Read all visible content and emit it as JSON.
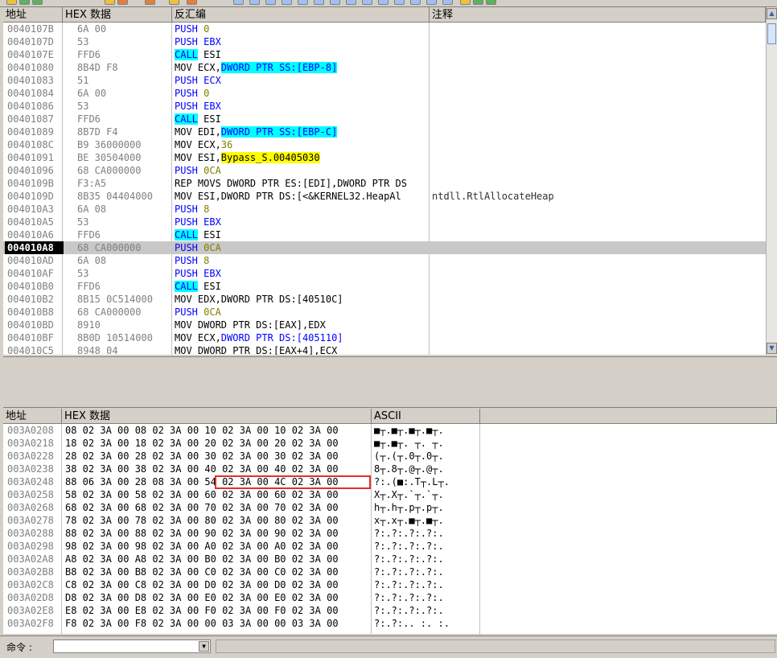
{
  "cpu": {
    "headers": {
      "address": "地址",
      "hex": "HEX 数据",
      "disasm": "反汇编",
      "comment": "注释"
    },
    "rows": [
      {
        "addr": "0040107B",
        "hex": "6A 00",
        "parts": [
          [
            "PUSH ",
            "blue"
          ],
          [
            "0",
            "olive"
          ]
        ]
      },
      {
        "addr": "0040107D",
        "hex": "53",
        "parts": [
          [
            "PUSH EBX",
            "blue"
          ]
        ]
      },
      {
        "addr": "0040107E",
        "hex": "FFD6",
        "parts": [
          [
            "CALL",
            "blue cyan"
          ],
          [
            " ESI",
            "mn"
          ]
        ]
      },
      {
        "addr": "00401080",
        "hex": "8B4D F8",
        "parts": [
          [
            "MOV ECX,",
            "mn"
          ],
          [
            "DWORD PTR SS:[EBP-8]",
            "blue cyan"
          ]
        ]
      },
      {
        "addr": "00401083",
        "hex": "51",
        "parts": [
          [
            "PUSH ECX",
            "blue"
          ]
        ]
      },
      {
        "addr": "00401084",
        "hex": "6A 00",
        "parts": [
          [
            "PUSH ",
            "blue"
          ],
          [
            "0",
            "olive"
          ]
        ]
      },
      {
        "addr": "00401086",
        "hex": "53",
        "parts": [
          [
            "PUSH EBX",
            "blue"
          ]
        ]
      },
      {
        "addr": "00401087",
        "hex": "FFD6",
        "parts": [
          [
            "CALL",
            "blue cyan"
          ],
          [
            " ESI",
            "mn"
          ]
        ]
      },
      {
        "addr": "00401089",
        "hex": "8B7D F4",
        "parts": [
          [
            "MOV EDI,",
            "mn"
          ],
          [
            "DWORD PTR SS:[EBP-C]",
            "blue cyan"
          ]
        ]
      },
      {
        "addr": "0040108C",
        "hex": "B9 36000000",
        "parts": [
          [
            "MOV ECX,",
            "mn"
          ],
          [
            "36",
            "olive"
          ]
        ]
      },
      {
        "addr": "00401091",
        "hex": "BE 30504000",
        "parts": [
          [
            "MOV ESI,",
            "mn"
          ],
          [
            "Bypass_S.00405030",
            "yel"
          ]
        ]
      },
      {
        "addr": "00401096",
        "hex": "68 CA000000",
        "parts": [
          [
            "PUSH ",
            "blue"
          ],
          [
            "0CA",
            "olive"
          ]
        ]
      },
      {
        "addr": "0040109B",
        "hex": "F3:A5",
        "parts": [
          [
            "REP MOVS DWORD PTR ES:[EDI],DWORD PTR DS",
            "mn"
          ]
        ]
      },
      {
        "addr": "0040109D",
        "hex": "8B35 04404000",
        "parts": [
          [
            "MOV ESI,DWORD PTR DS:[<&KERNEL32.HeapAl",
            "mn"
          ]
        ],
        "comment": "ntdll.RtlAllocateHeap"
      },
      {
        "addr": "004010A3",
        "hex": "6A 08",
        "parts": [
          [
            "PUSH ",
            "blue"
          ],
          [
            "8",
            "olive"
          ]
        ]
      },
      {
        "addr": "004010A5",
        "hex": "53",
        "parts": [
          [
            "PUSH EBX",
            "blue"
          ]
        ]
      },
      {
        "addr": "004010A6",
        "hex": "FFD6",
        "parts": [
          [
            "CALL",
            "blue cyan"
          ],
          [
            " ESI",
            "mn"
          ]
        ]
      },
      {
        "addr": "004010A8",
        "hex": "68 CA000000",
        "parts": [
          [
            "PUSH ",
            "blue"
          ],
          [
            "0CA",
            "olive"
          ]
        ],
        "current": true
      },
      {
        "addr": "004010AD",
        "hex": "6A 08",
        "parts": [
          [
            "PUSH ",
            "blue"
          ],
          [
            "8",
            "olive"
          ]
        ]
      },
      {
        "addr": "004010AF",
        "hex": "53",
        "parts": [
          [
            "PUSH EBX",
            "blue"
          ]
        ]
      },
      {
        "addr": "004010B0",
        "hex": "FFD6",
        "parts": [
          [
            "CALL",
            "blue cyan"
          ],
          [
            " ESI",
            "mn"
          ]
        ]
      },
      {
        "addr": "004010B2",
        "hex": "8B15 0C514000",
        "parts": [
          [
            "MOV EDX,DWORD PTR DS:[40510C]",
            "mn"
          ]
        ]
      },
      {
        "addr": "004010B8",
        "hex": "68 CA000000",
        "parts": [
          [
            "PUSH ",
            "blue"
          ],
          [
            "0CA",
            "olive"
          ]
        ]
      },
      {
        "addr": "004010BD",
        "hex": "8910",
        "parts": [
          [
            "MOV DWORD PTR DS:[EAX],EDX",
            "mn"
          ]
        ]
      },
      {
        "addr": "004010BF",
        "hex": "8B0D 10514000",
        "parts": [
          [
            "MOV ECX,",
            "mn"
          ],
          [
            "DWORD PTR DS:[405110]",
            "blue"
          ]
        ]
      },
      {
        "addr": "004010C5",
        "hex": "8948 04",
        "parts": [
          [
            "MOV DWORD PTR DS:[EAX+4],ECX",
            "mn"
          ]
        ]
      }
    ]
  },
  "dump": {
    "headers": {
      "address": "地址",
      "hex": "HEX 数据",
      "ascii": "ASCII"
    },
    "rows": [
      {
        "addr": "003A0208",
        "hex": "08 02 3A 00 08 02 3A 00 10 02 3A 00 10 02 3A 00",
        "ascii": "■┬.■┬.■┬.■┬."
      },
      {
        "addr": "003A0218",
        "hex": "18 02 3A 00 18 02 3A 00 20 02 3A 00 20 02 3A 00",
        "ascii": "■┬.■┬. ┬. ┬."
      },
      {
        "addr": "003A0228",
        "hex": "28 02 3A 00 28 02 3A 00 30 02 3A 00 30 02 3A 00",
        "ascii": "(┬.(┬.0┬.0┬."
      },
      {
        "addr": "003A0238",
        "hex": "38 02 3A 00 38 02 3A 00 40 02 3A 00 40 02 3A 00",
        "ascii": "8┬.8┬.@┬.@┬."
      },
      {
        "addr": "003A0248",
        "hex": "88 06 3A 00 28 08 3A 00 54 02 3A 00 4C 02 3A 00",
        "ascii": "?:.(■:.T┬.L┬."
      },
      {
        "addr": "003A0258",
        "hex": "58 02 3A 00 58 02 3A 00 60 02 3A 00 60 02 3A 00",
        "ascii": "X┬.X┬.`┬.`┬."
      },
      {
        "addr": "003A0268",
        "hex": "68 02 3A 00 68 02 3A 00 70 02 3A 00 70 02 3A 00",
        "ascii": "h┬.h┬.p┬.p┬."
      },
      {
        "addr": "003A0278",
        "hex": "78 02 3A 00 78 02 3A 00 80 02 3A 00 80 02 3A 00",
        "ascii": "x┬.x┬.■┬.■┬."
      },
      {
        "addr": "003A0288",
        "hex": "88 02 3A 00 88 02 3A 00 90 02 3A 00 90 02 3A 00",
        "ascii": "?:.?:.?:.?:."
      },
      {
        "addr": "003A0298",
        "hex": "98 02 3A 00 98 02 3A 00 A0 02 3A 00 A0 02 3A 00",
        "ascii": "?:.?:.?:.?:."
      },
      {
        "addr": "003A02A8",
        "hex": "A8 02 3A 00 A8 02 3A 00 B0 02 3A 00 B0 02 3A 00",
        "ascii": "?:.?:.?:.?:."
      },
      {
        "addr": "003A02B8",
        "hex": "B8 02 3A 00 B8 02 3A 00 C0 02 3A 00 C0 02 3A 00",
        "ascii": "?:.?:.?:.?:."
      },
      {
        "addr": "003A02C8",
        "hex": "C8 02 3A 00 C8 02 3A 00 D0 02 3A 00 D0 02 3A 00",
        "ascii": "?:.?:.?:.?:."
      },
      {
        "addr": "003A02D8",
        "hex": "D8 02 3A 00 D8 02 3A 00 E0 02 3A 00 E0 02 3A 00",
        "ascii": "?:.?:.?:.?:."
      },
      {
        "addr": "003A02E8",
        "hex": "E8 02 3A 00 E8 02 3A 00 F0 02 3A 00 F0 02 3A 00",
        "ascii": "?:.?:.?:.?:."
      },
      {
        "addr": "003A02F8",
        "hex": "F8 02 3A 00 F8 02 3A 00 00 03 3A 00 00 03 3A 00",
        "ascii": "?:.?:.. :. :."
      }
    ]
  },
  "command": {
    "label": "命令 :",
    "value": ""
  }
}
